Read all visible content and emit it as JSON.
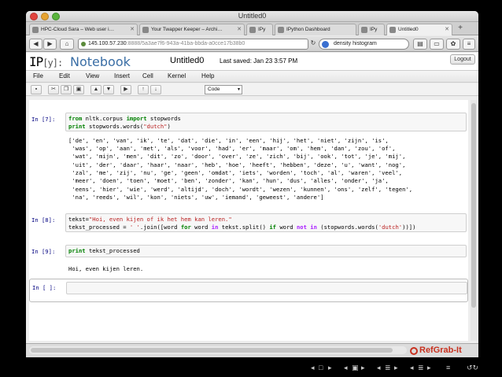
{
  "window": {
    "title": "Untitled0"
  },
  "tabs": [
    {
      "label": "HPC-Cloud Sara – Web user i…"
    },
    {
      "label": "Your Twapper Keeper – Archi…"
    },
    {
      "label": "IPy"
    },
    {
      "label": "IPython Dashboard"
    },
    {
      "label": "IPy"
    },
    {
      "label": "Untitled0"
    }
  ],
  "nav": {
    "url_host": "145.100.57.230",
    "url_rest": ":8888/5a3ae7f6-943a-41ba-bbda-a0cce17b38b0",
    "search_value": "density histogram"
  },
  "header": {
    "logo_ip": "IP",
    "logo_y": "[y]:",
    "logo_word": "Notebook",
    "notebook_name": "Untitled0",
    "last_saved": "Last saved: Jan 23 3:57 PM",
    "logout_label": "Logout"
  },
  "menu": [
    "File",
    "Edit",
    "View",
    "Insert",
    "Cell",
    "Kernel",
    "Help"
  ],
  "toolbar": {
    "cell_type": "Code",
    "buttons": [
      "save-icon",
      "cut-icon",
      "copy-icon",
      "paste-icon",
      "move-up-icon",
      "move-down-icon",
      "run-icon",
      "step-up-icon",
      "step-down-icon"
    ]
  },
  "cells": [
    {
      "prompt": "In [7]:",
      "input": [
        "from nltk.corpus import stopwords",
        "print stopwords.words(\"dutch\")"
      ],
      "output": [
        "['de', 'en', 'van', 'ik', 'te', 'dat', 'die', 'in', 'een', 'hij', 'het', 'niet', 'zijn', 'is',",
        " 'was', 'op', 'aan', 'met', 'als', 'voor', 'had', 'er', 'maar', 'om', 'hem', 'dan', 'zou', 'of',",
        " 'wat', 'mijn', 'men', 'dit', 'zo', 'door', 'over', 'ze', 'zich', 'bij', 'ook', 'tot', 'je', 'mij',",
        " 'uit', 'der', 'daar', 'haar', 'naar', 'heb', 'hoe', 'heeft', 'hebben', 'deze', 'u', 'want', 'nog',",
        " 'zal', 'me', 'zij', 'nu', 'ge', 'geen', 'omdat', 'iets', 'worden', 'toch', 'al', 'waren', 'veel',",
        " 'meer', 'doen', 'toen', 'moet', 'ben', 'zonder', 'kan', 'hun', 'dus', 'alles', 'onder', 'ja',",
        " 'eens', 'hier', 'wie', 'werd', 'altijd', 'doch', 'wordt', 'wezen', 'kunnen', 'ons', 'zelf', 'tegen',",
        " 'na', 'reeds', 'wil', 'kon', 'niets', 'uw', 'iemand', 'geweest', 'andere']"
      ]
    },
    {
      "prompt": "In [8]:",
      "input": [
        "tekst=\"Hoi, even kijen of ik het hem kan leren.\"",
        "tekst_processed = ' '.join([word for word in tekst.split() if word not in (stopwords.words('dutch'))])"
      ],
      "output": []
    },
    {
      "prompt": "In [9]:",
      "input": [
        "print tekst_processed"
      ],
      "output": [
        "Hoi, even kijen leren."
      ]
    },
    {
      "prompt": "In [ ]:",
      "input": [
        ""
      ],
      "output": []
    }
  ],
  "status": {
    "brand": "RefGrab-It"
  },
  "colors": {
    "keyword": "#008000",
    "string": "#ba2121",
    "prompt": "#000080",
    "brand": "#c8311f"
  }
}
